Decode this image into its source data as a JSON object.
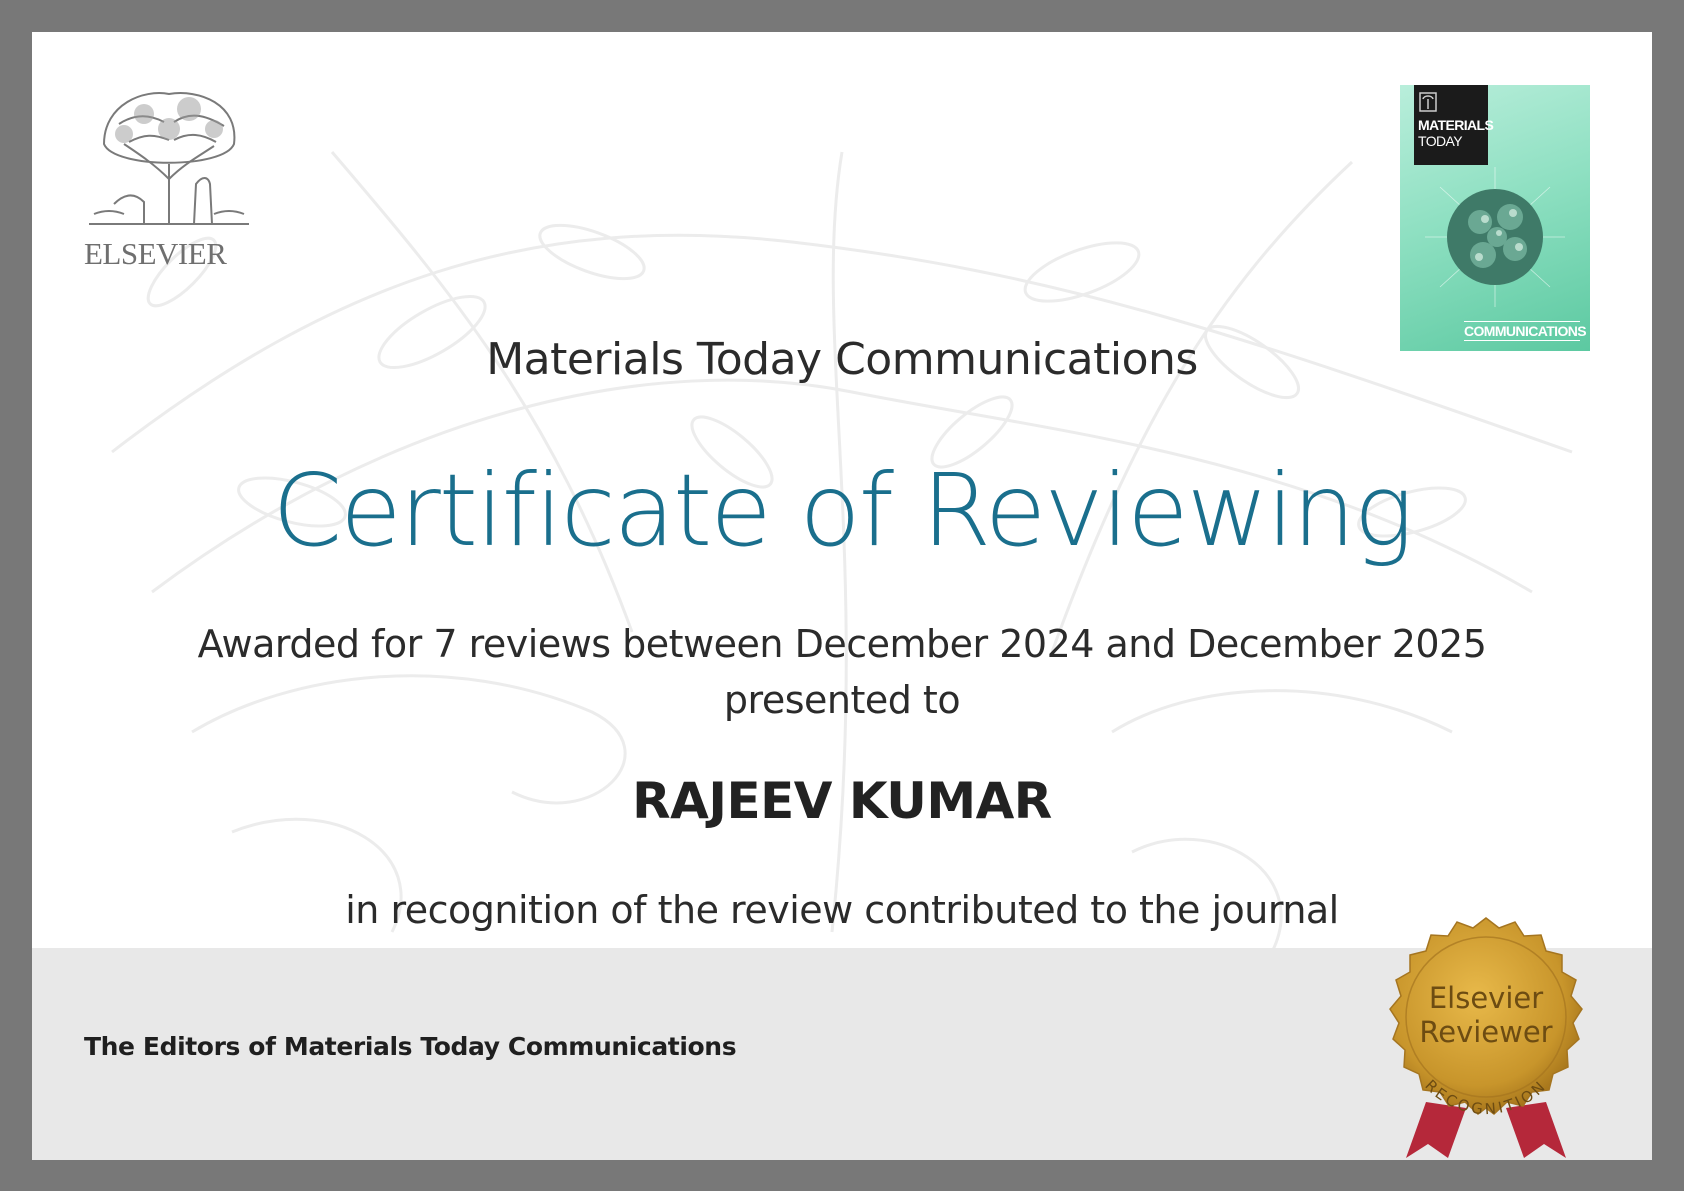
{
  "publisher": {
    "logo_word": "ELSEVIER"
  },
  "cover": {
    "title_line1": "MATERIALS",
    "title_line2": "TODAY",
    "subtitle": "COMMUNICATIONS"
  },
  "certificate": {
    "journal_name": "Materials Today Communications",
    "title": "Certificate of Reviewing",
    "awarded_line": "Awarded for 7 reviews between December 2024 and December 2025",
    "presented_line": "presented to",
    "recipient": "RAJEEV KUMAR",
    "recognition_line": "in recognition of the review contributed to the journal",
    "signatory": "The Editors of Materials Today Communications"
  },
  "seal": {
    "line1": "Elsevier",
    "line2": "Reviewer",
    "ring_text": "RECOGNITION"
  },
  "colors": {
    "frame": "#787878",
    "title_blue": "#1a6f8d",
    "footer_band": "#e8e8e8",
    "seal_gold": "#c8952b",
    "ribbon_red": "#b5283a",
    "cover_green": "#8fe0c2"
  }
}
